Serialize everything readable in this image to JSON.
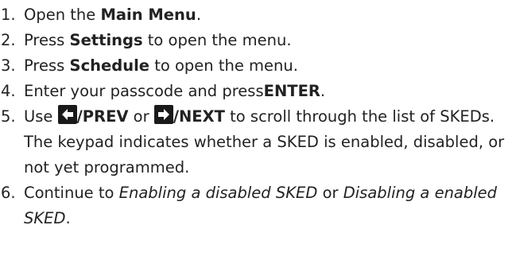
{
  "steps": [
    {
      "num": "1.",
      "pre": "Open the ",
      "bold": "Main Menu",
      "post": "."
    },
    {
      "num": "2.",
      "pre": "Press ",
      "bold": "Settings",
      "post": " to open the menu."
    },
    {
      "num": "3.",
      "pre": "Press ",
      "bold": "Schedule",
      "post": " to open the menu."
    },
    {
      "num": "4.",
      "pre": "Enter your passcode and press",
      "bold": "ENTER",
      "post": "."
    },
    {
      "num": "5.",
      "pre": "Use ",
      "icon1": "left-arrow-key-icon",
      "bold1": "/PREV",
      "mid": " or ",
      "icon2": "right-arrow-key-icon",
      "bold2": "/NEXT",
      "post": " to scroll through the list of SKEDs. The keypad indicates whether a SKED is enabled, disabled, or not yet programmed."
    },
    {
      "num": "6.",
      "pre": "Continue to ",
      "italic1": "Enabling a disabled SKED",
      "mid": " or ",
      "italic2": "Disabling a enabled SKED",
      "post": "."
    }
  ]
}
